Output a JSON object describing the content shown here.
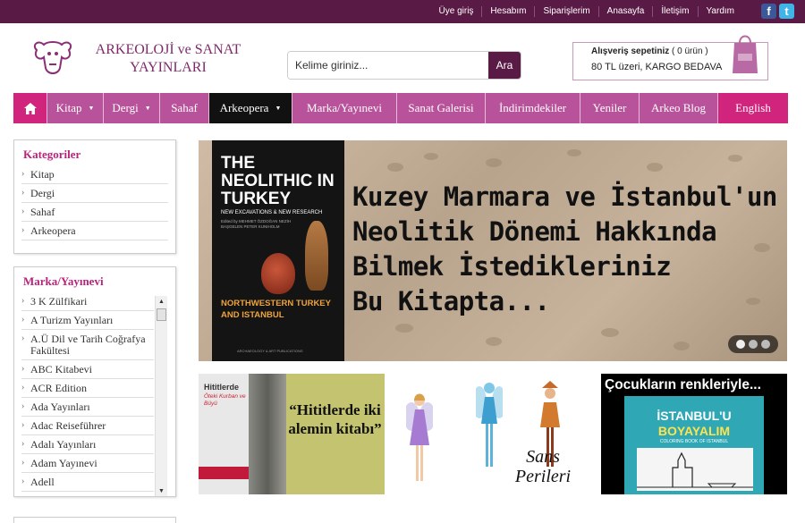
{
  "top_links": [
    "Üye giriş",
    "Hesabım",
    "Siparişlerim",
    "Anasayfa",
    "İletişim",
    "Yardım"
  ],
  "social": {
    "facebook": "f",
    "twitter": "t"
  },
  "logo": {
    "line1": "ARKEOLOJİ ve SANAT",
    "line2": "YAYINLARI"
  },
  "search": {
    "placeholder": "Kelime giriniz...",
    "button": "Ara"
  },
  "cart": {
    "label": "Alışveriş sepetiniz",
    "count": "( 0 ürün )",
    "promo_prefix": "80 TL üzeri, ",
    "promo_highlight": "KARGO BEDAVA"
  },
  "nav": {
    "home_icon": "home-icon",
    "items": [
      {
        "label": "Kitap",
        "dropdown": true
      },
      {
        "label": "Dergi",
        "dropdown": true
      },
      {
        "label": "Sahaf",
        "dropdown": false
      },
      {
        "label": "Arkeopera",
        "dropdown": true,
        "active": true
      },
      {
        "label": "Marka/Yayınevi",
        "dropdown": false
      },
      {
        "label": "Sanat Galerisi",
        "dropdown": false
      },
      {
        "label": "İndirimdekiler",
        "dropdown": false
      },
      {
        "label": "Yeniler",
        "dropdown": false
      },
      {
        "label": "Arkeo Blog",
        "dropdown": false
      },
      {
        "label": "English",
        "dropdown": false
      }
    ]
  },
  "categories": {
    "title": "Kategoriler",
    "items": [
      "Kitap",
      "Dergi",
      "Sahaf",
      "Arkeopera"
    ]
  },
  "brands": {
    "title": "Marka/Yayınevi",
    "items": [
      "3 K Zülfikari",
      "A Turizm Yayınları",
      "A.Ü Dil ve Tarih Coğrafya Fakültesi",
      "ABC Kitabevi",
      "ACR Edition",
      "Ada Yayınları",
      "Adac Reiseführer",
      "Adalı Yayınları",
      "Adam Yayınevi",
      "Adell"
    ]
  },
  "banner": {
    "book_title": "THE NEOLITHIC IN TURKEY",
    "book_subtitle": "NEW EXCAVATIONS & NEW RESEARCH",
    "book_editors": "Edited by MEHMET ÖZDOĞAN NEZİH BAŞGELEN PETER KUNIHOLM",
    "book_region": "NORTHWESTERN TURKEY AND ISTANBUL",
    "book_publisher": "ARCHAEOLOGY & ART PUBLICATIONS",
    "headline": [
      "Kuzey Marmara ve İstanbul'un",
      "Neolitik Dönemi Hakkında",
      "Bilmek İstedikleriniz",
      "Bu Kitapta..."
    ],
    "slide_count": 3,
    "active_slide": 1
  },
  "promos": {
    "hittite": {
      "cover_title": "Hititlerde",
      "cover_subtitle": "Öteki Kurban ve Büyü",
      "quote": "“Hititlerde iki alemin kitabı”"
    },
    "fairies": {
      "title": "Sans Perileri"
    },
    "istanbul": {
      "headline": "Çocukların renkleriyle...",
      "cover_line1": "İSTANBUL'U",
      "cover_line2": "BOYAYALIM",
      "cover_line3": "COLORING BOOK OF ISTANBUL"
    }
  },
  "colors": {
    "topbar": "#5a1a46",
    "nav": "#b8529a",
    "accent_pink": "#d1247d",
    "title_pink": "#b8237c"
  }
}
